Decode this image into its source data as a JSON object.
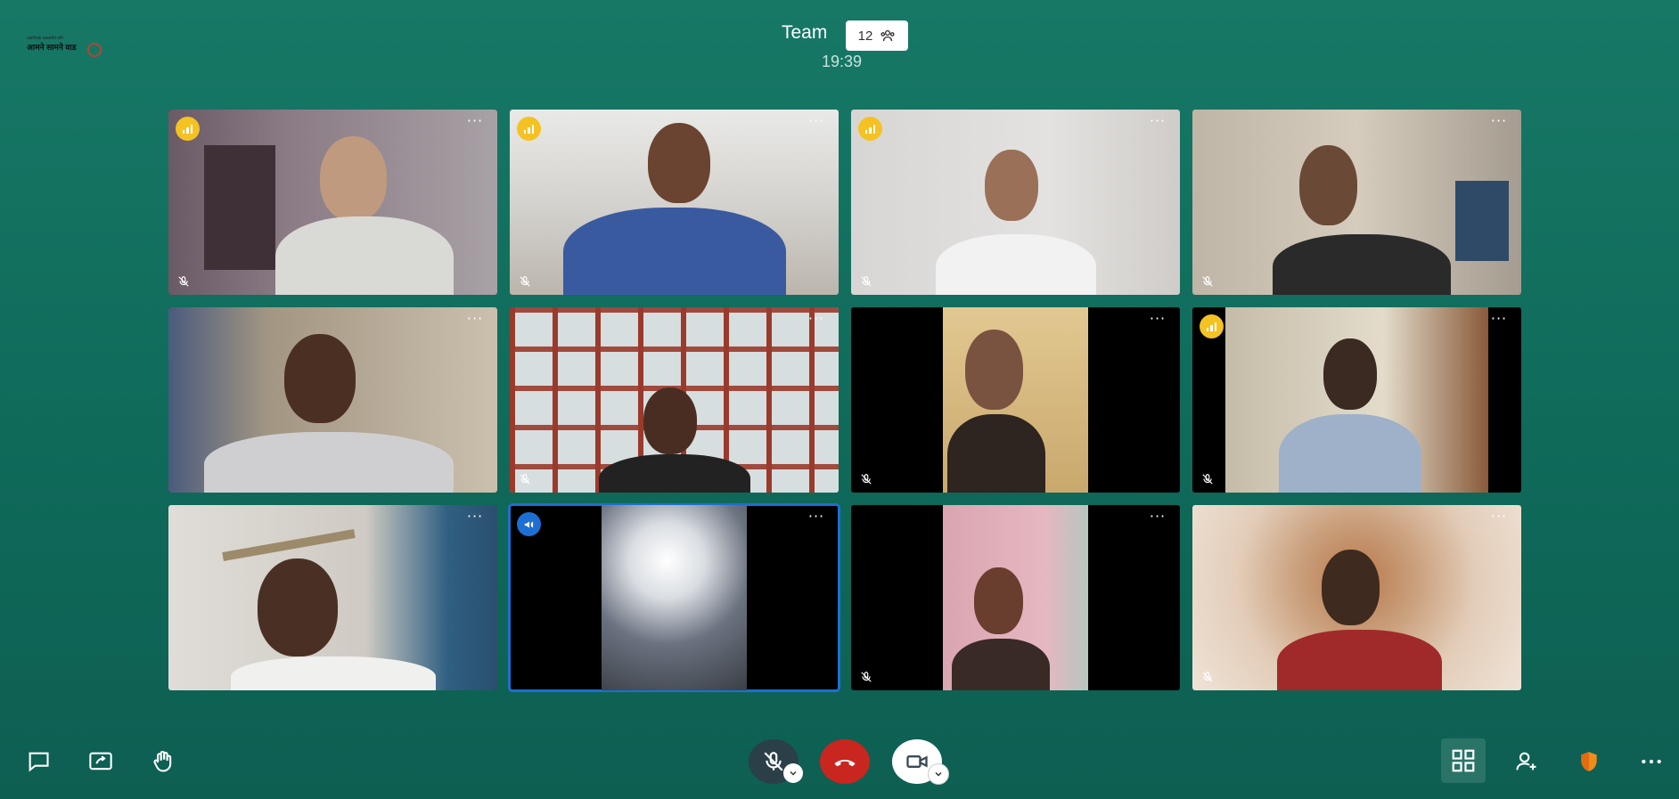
{
  "header": {
    "title": "Team",
    "participant_count": "12",
    "time": "19:39"
  },
  "logo": {
    "line1": "sarthak saarthi sth",
    "line2": "आमने सामने वाड"
  },
  "colors": {
    "background": "#177866",
    "signal_badge": "#f5c223",
    "active_speaker": "#1d6fd3",
    "hangup": "#c8261f"
  },
  "tiles": [
    {
      "id": "p1",
      "signal": true,
      "muted": true,
      "speaker": false
    },
    {
      "id": "p2",
      "signal": true,
      "muted": true,
      "speaker": false
    },
    {
      "id": "p3",
      "signal": true,
      "muted": true,
      "speaker": false
    },
    {
      "id": "p4",
      "signal": false,
      "muted": true,
      "speaker": false
    },
    {
      "id": "p5",
      "signal": false,
      "muted": false,
      "speaker": false
    },
    {
      "id": "p6",
      "signal": false,
      "muted": true,
      "speaker": false
    },
    {
      "id": "p7",
      "signal": false,
      "muted": true,
      "speaker": false
    },
    {
      "id": "p8",
      "signal": true,
      "muted": true,
      "speaker": false
    },
    {
      "id": "p9",
      "signal": false,
      "muted": false,
      "speaker": false
    },
    {
      "id": "p10",
      "signal": false,
      "muted": false,
      "speaker": true,
      "moderator": true
    },
    {
      "id": "p11",
      "signal": false,
      "muted": true,
      "speaker": false
    },
    {
      "id": "p12",
      "signal": false,
      "muted": true,
      "speaker": false
    }
  ],
  "toolbar": {
    "left": [
      "chat-icon",
      "share-screen-icon",
      "raise-hand-icon"
    ],
    "center": [
      "microphone-muted-icon",
      "hangup-icon",
      "camera-icon"
    ],
    "right": [
      "tile-view-icon",
      "invite-icon",
      "security-shield-icon",
      "more-icon"
    ],
    "tile_menu_label": "···"
  }
}
